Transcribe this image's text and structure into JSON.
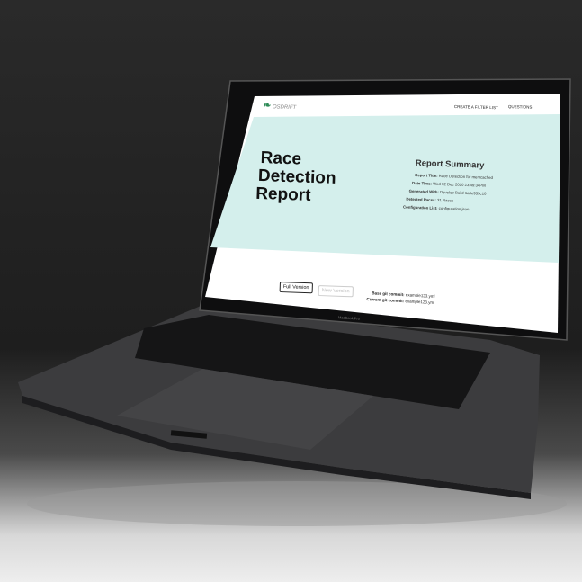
{
  "screen": {
    "logo_text": "OSDRIFT",
    "nav": [
      "CREATE A FILTER LIST",
      "QUESTIONS"
    ],
    "hero_title": [
      "Race",
      "Detection",
      "Report"
    ],
    "summary": {
      "heading": "Report Summary",
      "rows": [
        {
          "label": "Report Title:",
          "value": "Race Detection for memcached"
        },
        {
          "label": "Date Time:",
          "value": "Wed 02 Dec 2020 23:49:34PM"
        },
        {
          "label": "Generated With:",
          "value": "Develop Build 1a0e933c10"
        },
        {
          "label": "Detected Races:",
          "value": "31 Races"
        },
        {
          "label": "Configuration List:",
          "value": "configuration.json"
        }
      ]
    },
    "buttons": {
      "full": "Full Version",
      "new": "New Version"
    },
    "commits": [
      {
        "label": "Base git commit:",
        "value": "example123.yml"
      },
      {
        "label": "Current git commit:",
        "value": "example123.yml"
      }
    ],
    "accent": "#d4efec",
    "logo_color": "#2e8b57"
  },
  "laptop": {
    "brand_label": "MacBook Pro"
  }
}
